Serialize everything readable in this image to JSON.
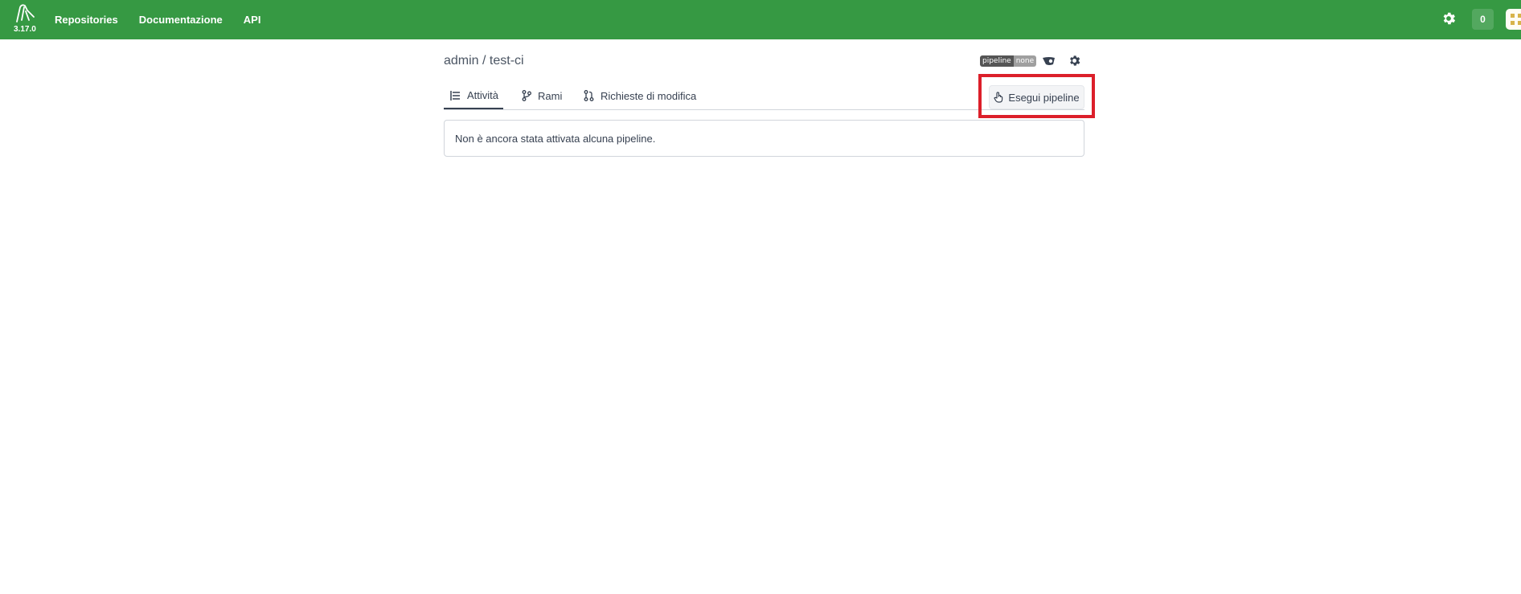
{
  "header": {
    "version": "3.17.0",
    "nav": [
      "Repositories",
      "Documentazione",
      "API"
    ],
    "counter": "0",
    "colors": {
      "bar": "#369943"
    }
  },
  "repo": {
    "title": "admin / test-ci",
    "badge_left": "pipeline",
    "badge_right": "none"
  },
  "tabs": [
    {
      "label": "Attività",
      "icon": "list-icon",
      "active": true
    },
    {
      "label": "Rami",
      "icon": "branch-icon",
      "active": false
    },
    {
      "label": "Richieste di modifica",
      "icon": "pull-request-icon",
      "active": false
    }
  ],
  "actions": {
    "run_pipeline": "Esegui pipeline"
  },
  "empty_message": "Non è ancora stata attivata alcuna pipeline.",
  "highlight_color": "#dc1f2a"
}
